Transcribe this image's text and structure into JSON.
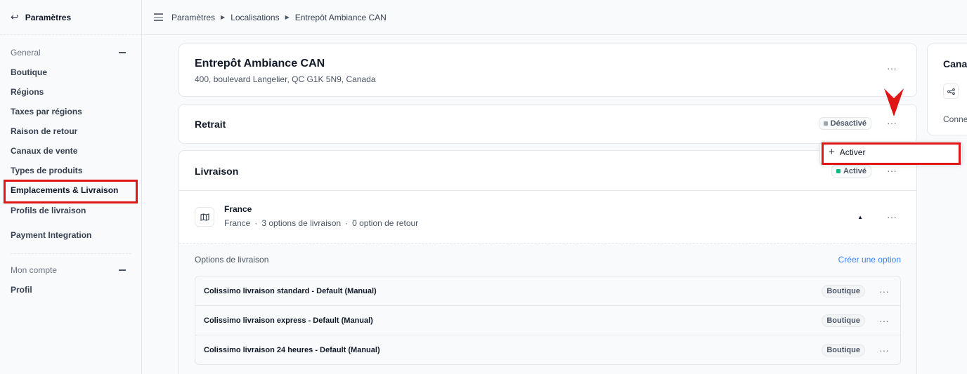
{
  "sidebar": {
    "back_title": "Paramètres",
    "general_heading": "General",
    "general_items": [
      "Boutique",
      "Régions",
      "Taxes par régions",
      "Raison de retour",
      "Canaux de vente",
      "Types de produits",
      "Emplacements & Livraison",
      "Profils de livraison",
      "Payment Integration"
    ],
    "active_item": "Emplacements & Livraison",
    "account_heading": "Mon compte",
    "account_items": [
      "Profil"
    ]
  },
  "breadcrumb": [
    "Paramètres",
    "Localisations",
    "Entrepôt Ambiance CAN"
  ],
  "location": {
    "name": "Entrepôt Ambiance CAN",
    "address": "400, boulevard Langelier, QC G1K 5N9, Canada"
  },
  "retrait": {
    "title": "Retrait",
    "status": "Désactivé",
    "status_color": "#9ca3af"
  },
  "dropdown": {
    "action_label": "Activer",
    "action_icon": "plus-icon"
  },
  "livraison": {
    "title": "Livraison",
    "status": "Activé",
    "status_color": "#10b981",
    "zone": {
      "name": "France",
      "region": "France",
      "sep": "·",
      "shipping_count": "3 options de livraison",
      "return_count": "0 option de retour"
    },
    "options_heading": "Options de livraison",
    "create_link": "Créer une option",
    "options": [
      {
        "name": "Colissimo livraison standard - Default (Manual)",
        "tag": "Boutique"
      },
      {
        "name": "Colissimo livraison express - Default (Manual)",
        "tag": "Boutique"
      },
      {
        "name": "Colissimo livraison 24 heures - Default (Manual)",
        "tag": "Boutique"
      }
    ]
  },
  "side_card": {
    "title_partial": "Cana",
    "text_partial": "Conne",
    "icon": "share-icon"
  },
  "colors": {
    "accent": "#3b82f6",
    "annotation": "#e01515"
  }
}
